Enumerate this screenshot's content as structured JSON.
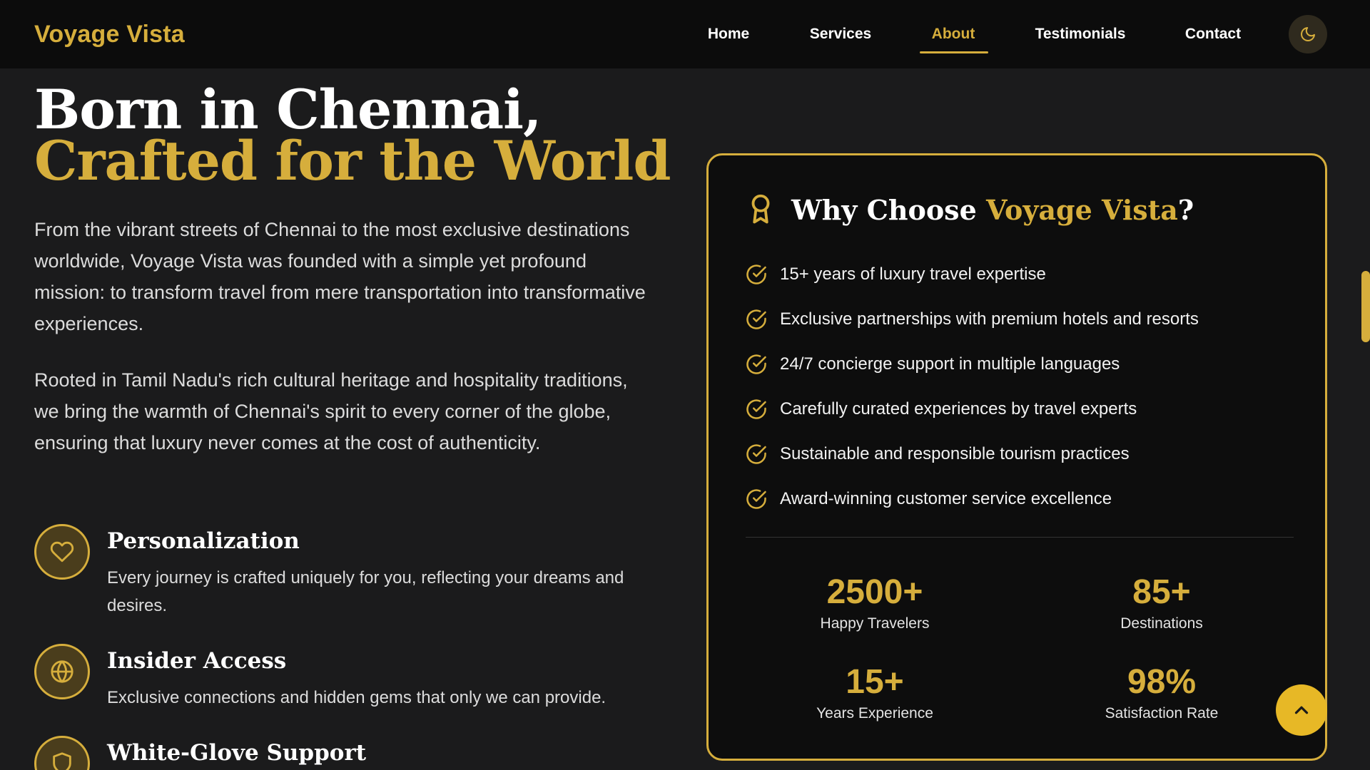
{
  "nav": {
    "brand": "Voyage Vista",
    "links": [
      "Home",
      "Services",
      "About",
      "Testimonials",
      "Contact"
    ],
    "active": "About",
    "theme_icon": "moon-icon"
  },
  "hero": {
    "title_line1": "Born in Chennai,",
    "title_line2": "Crafted for the World",
    "paragraphs": [
      "From the vibrant streets of Chennai to the most exclusive destinations worldwide, Voyage Vista was founded with a simple yet profound mission: to transform travel from mere transportation into transformative experiences.",
      "Rooted in Tamil Nadu's rich cultural heritage and hospitality traditions, we bring the warmth of Chennai's spirit to every corner of the globe, ensuring that luxury never comes at the cost of authenticity."
    ]
  },
  "features": [
    {
      "icon": "heart-icon",
      "title": "Personalization",
      "desc": "Every journey is crafted uniquely for you, reflecting your dreams and desires."
    },
    {
      "icon": "globe-icon",
      "title": "Insider Access",
      "desc": "Exclusive connections and hidden gems that only we can provide."
    },
    {
      "icon": "shield-icon",
      "title": "White-Glove Support",
      "desc": ""
    }
  ],
  "why": {
    "title_prefix": "Why Choose ",
    "title_accent": "Voyage Vista",
    "title_suffix": "?",
    "icon": "award-icon",
    "reasons": [
      "15+ years of luxury travel expertise",
      "Exclusive partnerships with premium hotels and resorts",
      "24/7 concierge support in multiple languages",
      "Carefully curated experiences by travel experts",
      "Sustainable and responsible tourism practices",
      "Award-winning customer service excellence"
    ],
    "stats": [
      {
        "value": "2500+",
        "label": "Happy Travelers"
      },
      {
        "value": "85+",
        "label": "Destinations"
      },
      {
        "value": "15+",
        "label": "Years Experience"
      },
      {
        "value": "98%",
        "label": "Satisfaction Rate"
      }
    ]
  },
  "colors": {
    "accent": "#d6ae3c",
    "background": "#1b1b1c",
    "navbar": "#0c0c0c",
    "card": "#0d0d0d",
    "scroll_button": "#e7b826"
  },
  "scroll_top_icon": "chevron-up-icon"
}
